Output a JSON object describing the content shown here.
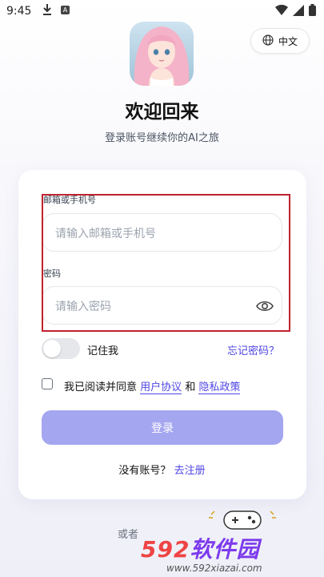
{
  "status_bar": {
    "time": "9:45",
    "badge": "A"
  },
  "lang_button": {
    "label": "中文"
  },
  "header": {
    "title": "欢迎回来",
    "subtitle": "登录账号继续你的AI之旅"
  },
  "form": {
    "account_label": "邮箱或手机号",
    "account_placeholder": "请输入邮箱或手机号",
    "password_label": "密码",
    "password_placeholder": "请输入密码",
    "remember_label": "记住我",
    "forgot_label": "忘记密码？",
    "agree_prefix": "我已阅读并同意",
    "terms_link": "用户协议",
    "agree_and": "和",
    "privacy_link": "隐私政策",
    "login_label": "登录",
    "no_account": "没有账号？",
    "register_link": "去注册"
  },
  "footer": {
    "or_label": "或者"
  },
  "watermark": {
    "brand_num": "592",
    "brand_cn": "软件园",
    "url": "www.592xiazai.com"
  },
  "colors": {
    "accent": "#4f46e5",
    "button": "#a5a6f0",
    "highlight_border": "#c0222f"
  },
  "icons": [
    "download-icon",
    "wifi-icon",
    "signal-icon",
    "battery-icon",
    "globe-icon",
    "eye-icon",
    "gamepad-icon"
  ]
}
